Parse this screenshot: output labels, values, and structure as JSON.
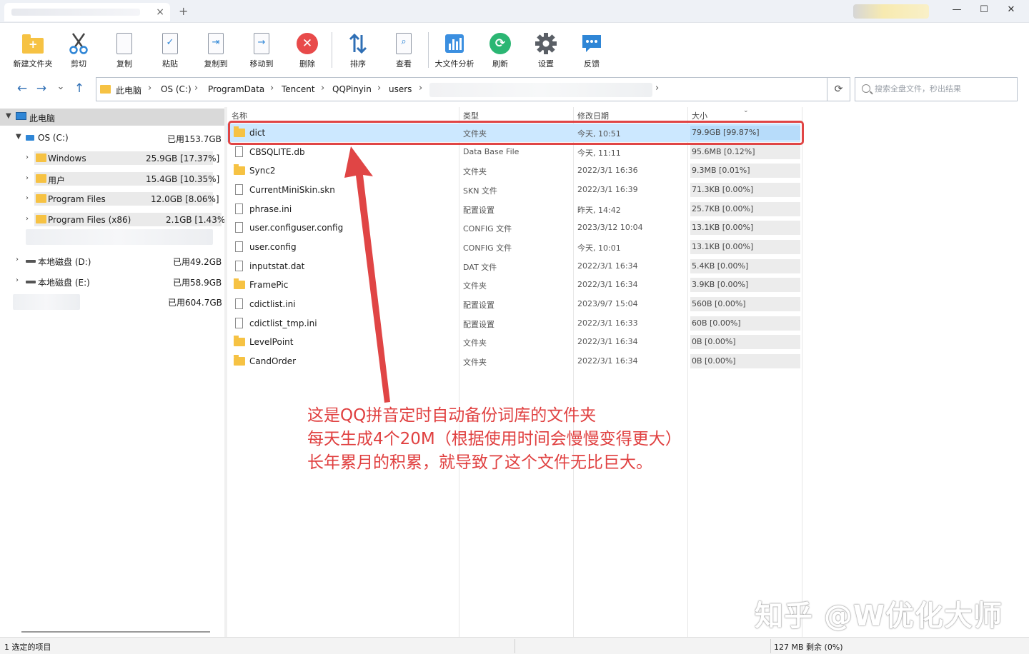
{
  "window": {
    "tab_close": "×",
    "tab_add": "+",
    "min": "—",
    "max": "☐",
    "close": "✕"
  },
  "toolbar": {
    "items": [
      {
        "label": "新建文件夹",
        "icon": "new-folder-icon"
      },
      {
        "label": "剪切",
        "icon": "scissors-icon"
      },
      {
        "label": "复制",
        "icon": "copy-icon"
      },
      {
        "label": "粘贴",
        "icon": "paste-icon"
      },
      {
        "label": "复制到",
        "icon": "copy-to-icon"
      },
      {
        "label": "移动到",
        "icon": "move-to-icon"
      },
      {
        "label": "删除",
        "icon": "delete-icon"
      },
      {
        "label": "排序",
        "icon": "sort-icon"
      },
      {
        "label": "查看",
        "icon": "view-icon"
      },
      {
        "label": "大文件分析",
        "icon": "chart-icon"
      },
      {
        "label": "刷新",
        "icon": "refresh-icon"
      },
      {
        "label": "设置",
        "icon": "gear-icon"
      },
      {
        "label": "反馈",
        "icon": "feedback-icon"
      }
    ]
  },
  "nav": {
    "back": "←",
    "forward": "→",
    "recent": "⌄",
    "up": "↑",
    "breadcrumb": [
      "此电脑",
      "OS (C:)",
      "ProgramData",
      "Tencent",
      "QQPinyin",
      "users"
    ],
    "sep": "›",
    "refresh": "⟳",
    "search_placeholder": "搜索全盘文件，秒出结果"
  },
  "tree": {
    "root": {
      "label": "此电脑"
    },
    "items": [
      {
        "label": "OS (C:)",
        "size": "已用153.7GB"
      },
      {
        "label": "Windows",
        "size": "25.9GB [17.37%]"
      },
      {
        "label": "用户",
        "size": "15.4GB [10.35%]"
      },
      {
        "label": "Program Files",
        "size": "12.0GB [8.06%]"
      },
      {
        "label": "Program Files (x86)",
        "size": "2.1GB [1.43%]"
      },
      {
        "label": "本地磁盘 (D:)",
        "size": "已用49.2GB"
      },
      {
        "label": "本地磁盘 (E:)",
        "size": "已用58.9GB"
      },
      {
        "label": "",
        "size": "已用604.7GB"
      }
    ]
  },
  "list": {
    "columns": [
      "名称",
      "类型",
      "修改日期",
      "大小"
    ],
    "sort_indicator": "⌄",
    "rows": [
      {
        "name": "dict",
        "type": "文件夹",
        "date": "今天, 10:51",
        "size": "79.9GB [99.87%]",
        "folder": true,
        "selected": true
      },
      {
        "name": "CBSQLITE.db",
        "type": "Data Base File",
        "date": "今天, 11:11",
        "size": "95.6MB [0.12%]",
        "folder": false
      },
      {
        "name": "Sync2",
        "type": "文件夹",
        "date": "2022/3/1 16:36",
        "size": "9.3MB [0.01%]",
        "folder": true
      },
      {
        "name": "CurrentMiniSkin.skn",
        "type": "SKN 文件",
        "date": "2022/3/1 16:39",
        "size": "71.3KB [0.00%]",
        "folder": false
      },
      {
        "name": "phrase.ini",
        "type": "配置设置",
        "date": "昨天, 14:42",
        "size": "25.7KB [0.00%]",
        "folder": false
      },
      {
        "name": "user.configuser.config",
        "type": "CONFIG 文件",
        "date": "2023/3/12 10:04",
        "size": "13.1KB [0.00%]",
        "folder": false
      },
      {
        "name": "user.config",
        "type": "CONFIG 文件",
        "date": "今天, 10:01",
        "size": "13.1KB [0.00%]",
        "folder": false
      },
      {
        "name": "inputstat.dat",
        "type": "DAT 文件",
        "date": "2022/3/1 16:34",
        "size": "5.4KB [0.00%]",
        "folder": false
      },
      {
        "name": "FramePic",
        "type": "文件夹",
        "date": "2022/3/1 16:34",
        "size": "3.9KB [0.00%]",
        "folder": true
      },
      {
        "name": "cdictlist.ini",
        "type": "配置设置",
        "date": "2023/9/7 15:04",
        "size": "560B [0.00%]",
        "folder": false
      },
      {
        "name": "cdictlist_tmp.ini",
        "type": "配置设置",
        "date": "2022/3/1 16:33",
        "size": "60B [0.00%]",
        "folder": false
      },
      {
        "name": "LevelPoint",
        "type": "文件夹",
        "date": "2022/3/1 16:34",
        "size": "0B [0.00%]",
        "folder": true
      },
      {
        "name": "CandOrder",
        "type": "文件夹",
        "date": "2022/3/1 16:34",
        "size": "0B [0.00%]",
        "folder": true
      }
    ]
  },
  "annotation": {
    "lines": [
      "这是QQ拼音定时自动备份词库的文件夹",
      "每天生成4个20M（根据使用时间会慢慢变得更大）",
      "长年累月的积累，就导致了这个文件无比巨大。"
    ],
    "color": "#e04040"
  },
  "watermark": "知乎 @W优化大师",
  "status": {
    "left": "1 选定的项目",
    "right": "127 MB 剩余 (0%)"
  }
}
